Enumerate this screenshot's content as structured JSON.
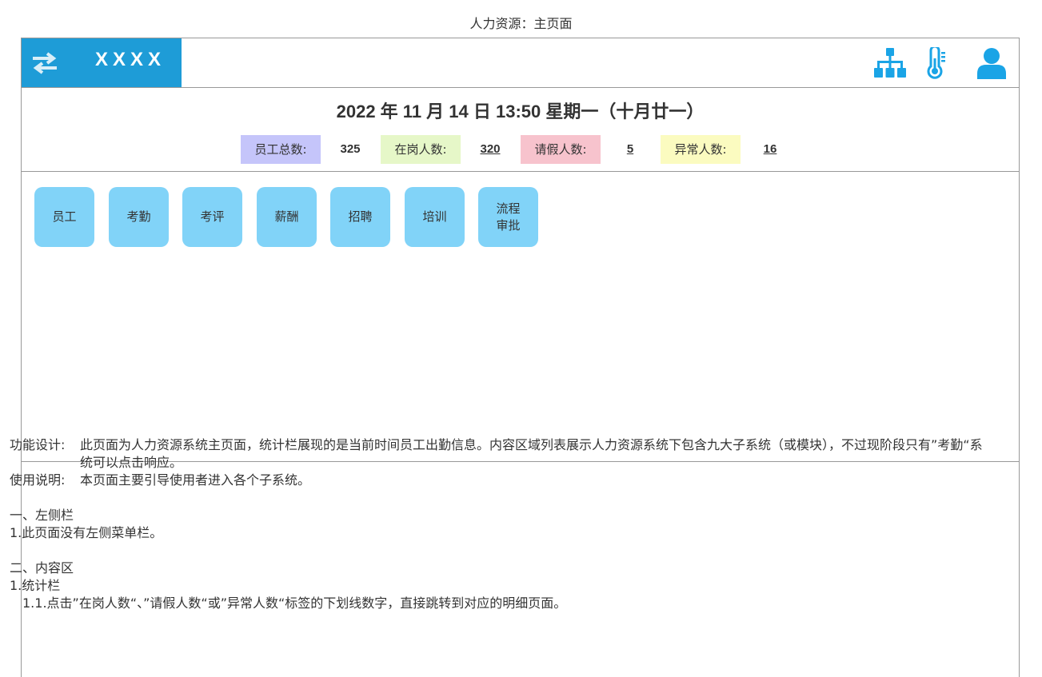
{
  "page_title": "人力资源：主页面",
  "header": {
    "brand": "XXXX",
    "icons": [
      "swap-arrows-icon",
      "org-chart-icon",
      "thermometer-icon",
      "user-icon"
    ],
    "brand_color": "#1e9cd7",
    "icon_color": "#1aa4e6"
  },
  "datebar": {
    "datetime": "2022 年 11 月 14 日 13:50  星期一（十月廿一）",
    "stats": [
      {
        "label": "员工总数:",
        "value": "325",
        "color": "#c5c5fa"
      },
      {
        "label": "在岗人数:",
        "value": "320",
        "color": "#e6f7c8"
      },
      {
        "label": "请假人数:",
        "value": "5",
        "color": "#f7c3cd"
      },
      {
        "label": "异常人数:",
        "value": "16",
        "color": "#fbfbc0"
      }
    ]
  },
  "modules": [
    {
      "label": "员工"
    },
    {
      "label": "考勤"
    },
    {
      "label": "考评"
    },
    {
      "label": "薪酬"
    },
    {
      "label": "招聘"
    },
    {
      "label": "培训"
    },
    {
      "label": "流程\n审批"
    }
  ],
  "module_color": "#81d3f8",
  "notes": {
    "design_key": "功能设计:",
    "design_value": "此页面为人力资源系统主页面，统计栏展现的是当前时间员工出勤信息。内容区域列表展示人力资源系统下包含九大子系统（或模块），不过现阶段只有”考勤“系统可以点击响应。",
    "usage_key": "使用说明:",
    "usage_value": "本页面主要引导使用者进入各个子系统。",
    "sec1_title": "一、左侧栏",
    "sec1_item1": "1.此页面没有左侧菜单栏。",
    "sec2_title": "二、内容区",
    "sec2_item1": "1.统计栏",
    "sec2_item1_1": "1.1.点击”在岗人数“、”请假人数“或”异常人数“标签的下划线数字，直接跳转到对应的明细页面。"
  }
}
